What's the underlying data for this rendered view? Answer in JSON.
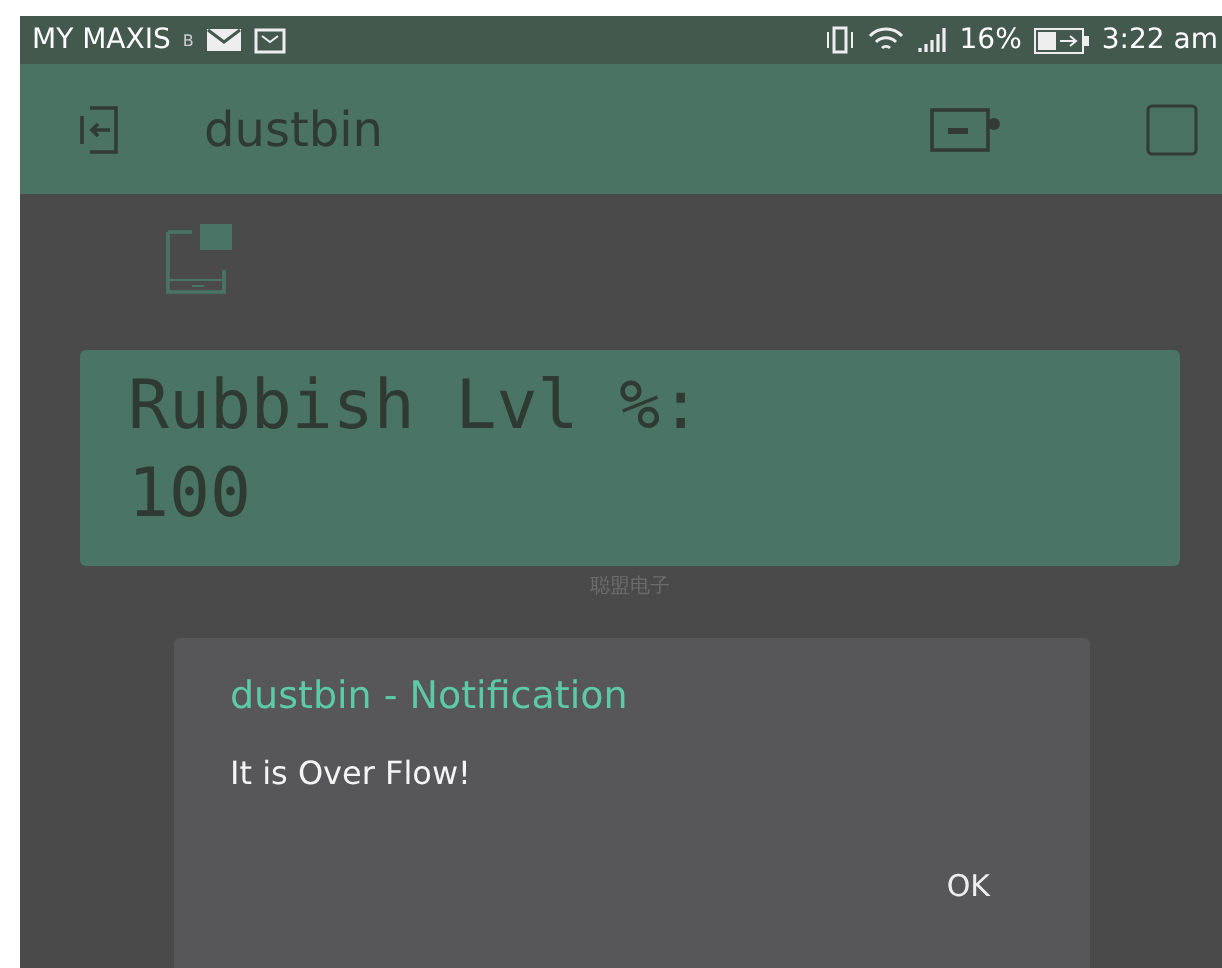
{
  "status_bar": {
    "carrier": "MY MAXIS",
    "badge": "B",
    "battery": "16%",
    "time": "3:22 am"
  },
  "app_bar": {
    "title": "dustbin"
  },
  "lcd": {
    "lines": [
      "Rubbish Lvl %:",
      "100"
    ],
    "caption": "聪盟电子"
  },
  "dialog": {
    "title": "dustbin - Notification",
    "message": "It is Over Flow!",
    "button": "OK"
  }
}
